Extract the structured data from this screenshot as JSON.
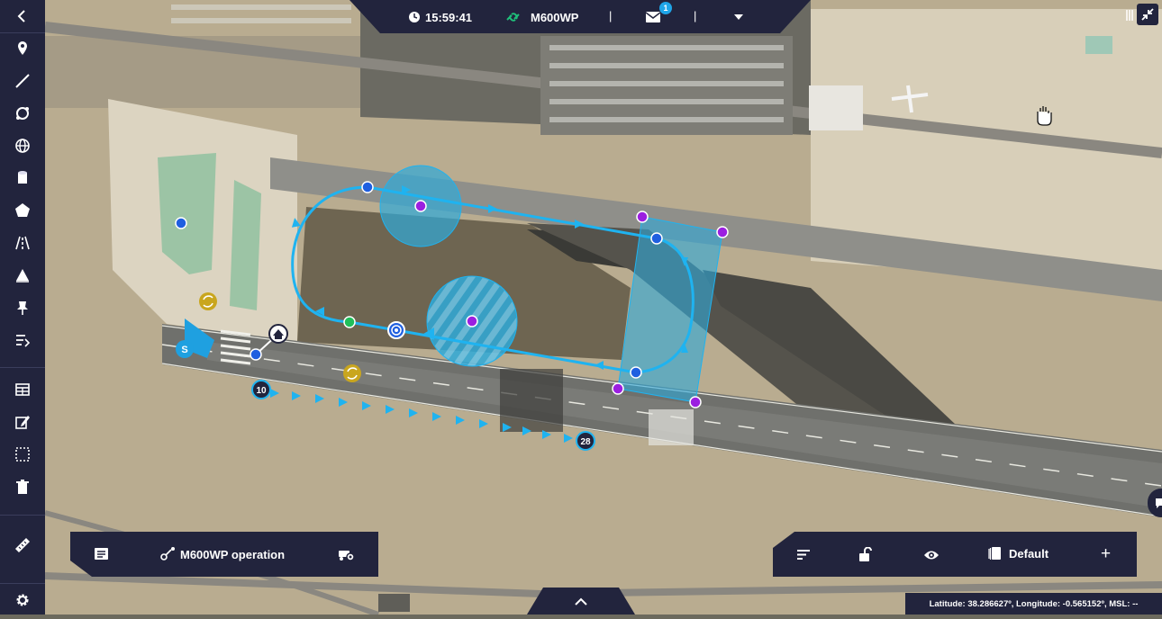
{
  "app": {
    "time": "15:59:41",
    "aircraft": "M600WP",
    "separator": "|",
    "unread_messages": "1"
  },
  "sidebar": {
    "items": [
      {
        "icon": "chevron-left-icon",
        "label": "collapse"
      },
      {
        "icon": "map-pin-icon",
        "label": "point"
      },
      {
        "icon": "line-icon",
        "label": "line"
      },
      {
        "icon": "orbit-icon",
        "label": "orbit"
      },
      {
        "icon": "globe-icon",
        "label": "globe"
      },
      {
        "icon": "cylinder-icon",
        "label": "cylinder"
      },
      {
        "icon": "polygon-icon",
        "label": "polygon"
      },
      {
        "icon": "runway-icon",
        "label": "runway"
      },
      {
        "icon": "tent-icon",
        "label": "tent"
      },
      {
        "icon": "pin-icon",
        "label": "pin"
      },
      {
        "icon": "route-icon",
        "label": "route"
      },
      {
        "icon": "table-icon",
        "label": "table"
      },
      {
        "icon": "edit-icon",
        "label": "edit"
      },
      {
        "icon": "select-area-icon",
        "label": "select"
      },
      {
        "icon": "trash-icon",
        "label": "delete"
      },
      {
        "icon": "ruler-icon",
        "label": "ruler"
      },
      {
        "icon": "gear-icon",
        "label": "settings"
      }
    ]
  },
  "bottom_left_panel": {
    "operation_label": "M600WP operation"
  },
  "bottom_right_panel": {
    "layer_label": "Default",
    "add_label": "+"
  },
  "status": {
    "coordinates": "Latitude: 38.286627º, Longitude: -0.565152º, MSL: --"
  },
  "map": {
    "runway_start_label": "10",
    "runway_end_label": "28",
    "start_marker_label": "S",
    "colors": {
      "route": "#1fb3f0",
      "waypoint_blue": "#1f5fe0",
      "waypoint_purple": "#9b1fe0",
      "waypoint_green": "#1fbf5a",
      "sync_marker": "#c9a61e",
      "zone_fill": "#2fa9d9"
    }
  }
}
